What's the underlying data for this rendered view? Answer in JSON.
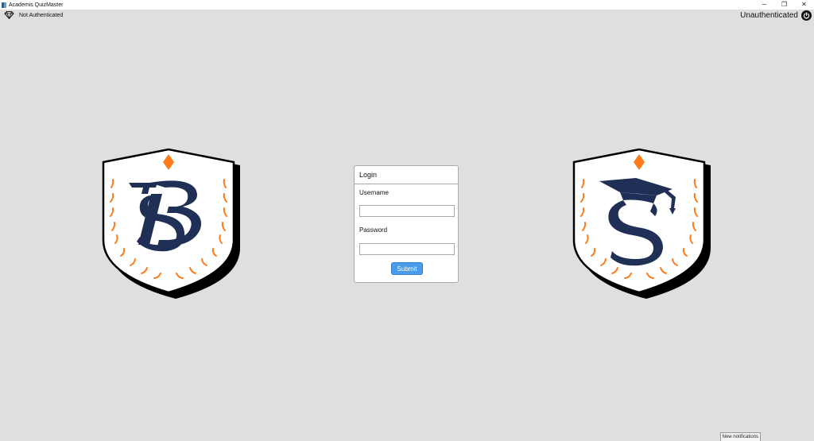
{
  "window": {
    "title": "Academis QuizMaster",
    "controls": {
      "minimize": "─",
      "restore": "❐",
      "close": "✕"
    }
  },
  "header": {
    "auth_status": "Not Authenticated",
    "user_status": "Unauthenticated"
  },
  "login": {
    "title": "Login",
    "username_label": "Username",
    "username_value": "",
    "password_label": "Password",
    "password_value": "",
    "submit_label": "Submit"
  },
  "notification": {
    "label": "New notifications"
  },
  "icons": {
    "app": "app-icon",
    "auth": "diamond-icon",
    "power": "power-icon",
    "crest_left": "sb-crest-logo",
    "crest_right": "s-graduation-crest-logo"
  },
  "colors": {
    "background": "#dfdfdf",
    "crest_navy": "#1f2f55",
    "crest_orange": "#ff7b1a",
    "submit_blue": "#4a9be8"
  }
}
